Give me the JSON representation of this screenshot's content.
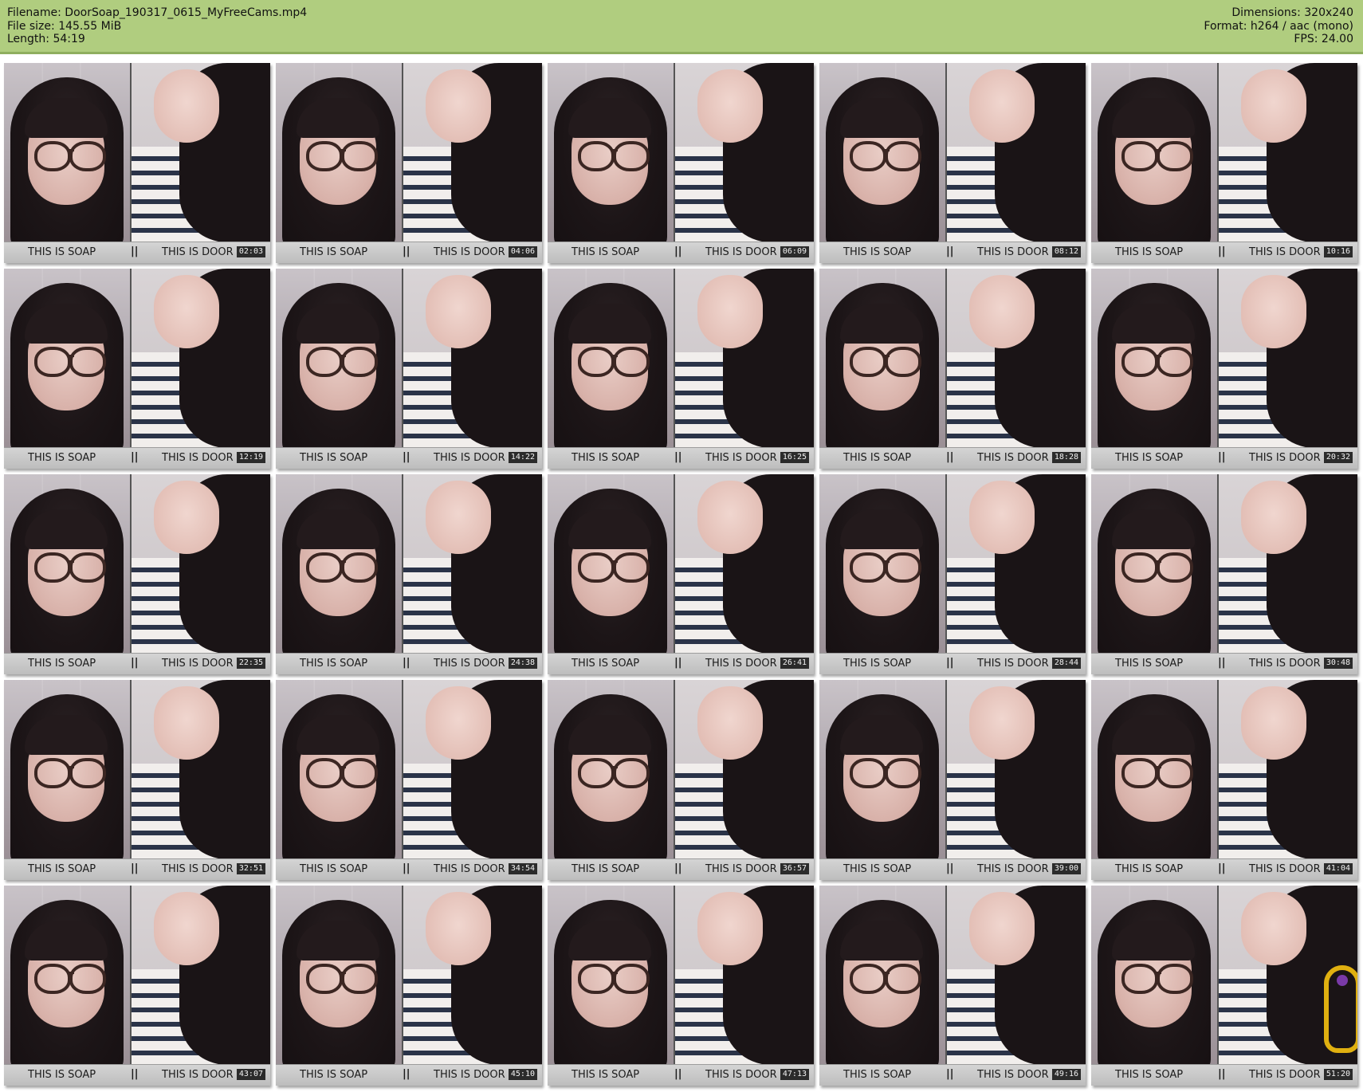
{
  "header": {
    "filename": "Filename: DoorSoap_190317_0615_MyFreeCams.mp4",
    "filesize": "File size: 145.55 MiB",
    "length": "Length: 54:19",
    "dimensions": "Dimensions: 320x240",
    "format": "Format: h264 / aac (mono)",
    "fps": "FPS: 24.00"
  },
  "colors": {
    "header_bg": "#b0cd7f",
    "caption_bg": "#c8c8c8",
    "doodle": "#e0b010"
  },
  "caption": {
    "left": "THIS IS SOAP",
    "separator": "||",
    "right": "THIS IS DOOR"
  },
  "thumbnails": [
    {
      "timestamp": "02:03"
    },
    {
      "timestamp": "04:06"
    },
    {
      "timestamp": "06:09"
    },
    {
      "timestamp": "08:12"
    },
    {
      "timestamp": "10:16"
    },
    {
      "timestamp": "12:19"
    },
    {
      "timestamp": "14:22"
    },
    {
      "timestamp": "16:25"
    },
    {
      "timestamp": "18:28"
    },
    {
      "timestamp": "20:32"
    },
    {
      "timestamp": "22:35"
    },
    {
      "timestamp": "24:38"
    },
    {
      "timestamp": "26:41"
    },
    {
      "timestamp": "28:44"
    },
    {
      "timestamp": "30:48"
    },
    {
      "timestamp": "32:51"
    },
    {
      "timestamp": "34:54"
    },
    {
      "timestamp": "36:57"
    },
    {
      "timestamp": "39:00"
    },
    {
      "timestamp": "41:04"
    },
    {
      "timestamp": "43:07"
    },
    {
      "timestamp": "45:10"
    },
    {
      "timestamp": "47:13"
    },
    {
      "timestamp": "49:16"
    },
    {
      "timestamp": "51:20"
    }
  ]
}
